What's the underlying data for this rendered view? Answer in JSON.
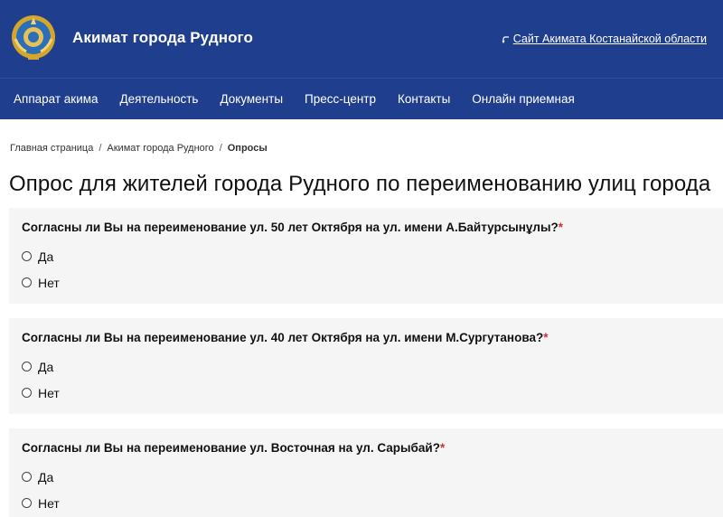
{
  "header": {
    "emblem_icon": "kazakhstan-state-emblem",
    "site_title": "Акимат города Рудного",
    "regional_link_icon": "return-arrow-icon",
    "regional_link_label": "Сайт Акимата Костанайской области"
  },
  "nav": {
    "items": [
      {
        "label": "Аппарат акима"
      },
      {
        "label": "Деятельность"
      },
      {
        "label": "Документы"
      },
      {
        "label": "Пресс-центр"
      },
      {
        "label": "Контакты"
      },
      {
        "label": "Онлайн приемная"
      }
    ]
  },
  "breadcrumb": {
    "items": [
      {
        "label": "Главная страница"
      },
      {
        "label": "Акимат города Рудного"
      },
      {
        "label": "Опросы"
      }
    ],
    "separator": "/"
  },
  "page_title": "Опрос для жителей города Рудного по переименованию улиц города",
  "questions": [
    {
      "text": "Согласны ли Вы на переименование ул. 50 лет Октября на ул. имени А.Байтурсынұлы?",
      "required_mark": "*",
      "options": [
        {
          "label": "Да"
        },
        {
          "label": "Нет"
        }
      ]
    },
    {
      "text": "Согласны ли Вы на переименование ул. 40 лет Октября на ул. имени М.Сургутанова?",
      "required_mark": "*",
      "options": [
        {
          "label": "Да"
        },
        {
          "label": "Нет"
        }
      ]
    },
    {
      "text": "Согласны ли Вы на переименование ул. Восточная на ул. Сарыбай?",
      "required_mark": "*",
      "options": [
        {
          "label": "Да"
        },
        {
          "label": "Нет"
        }
      ]
    }
  ],
  "colors": {
    "header_bg": "#1f3f8e",
    "card_bg": "#f5f5f5",
    "required": "#d32f2f"
  }
}
